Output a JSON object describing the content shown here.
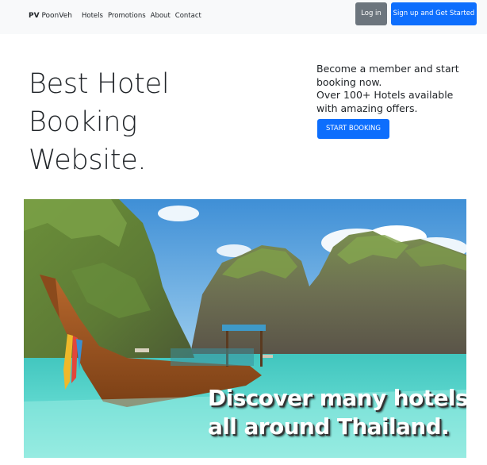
{
  "navbar": {
    "brand_short": "PV",
    "brand_name": "PoonVeh",
    "links": [
      "Hotels",
      "Promotions",
      "About",
      "Contact"
    ],
    "login_label": "Log in",
    "signup_label": "Sign up and Get Started"
  },
  "hero": {
    "title_lines": [
      "Best Hotel",
      "Booking",
      "Website."
    ],
    "promo_lines": [
      "Become a member and start",
      "booking now.",
      "Over 100+ Hotels available",
      "with amazing offers."
    ],
    "cta_label": "START BOOKING"
  },
  "banner": {
    "caption_lines": [
      "Discover many hotels",
      "all around Thailand."
    ]
  },
  "colors": {
    "primary": "#0d6efd",
    "secondary": "#6c757d",
    "navbar_bg": "#f8f9fa"
  }
}
